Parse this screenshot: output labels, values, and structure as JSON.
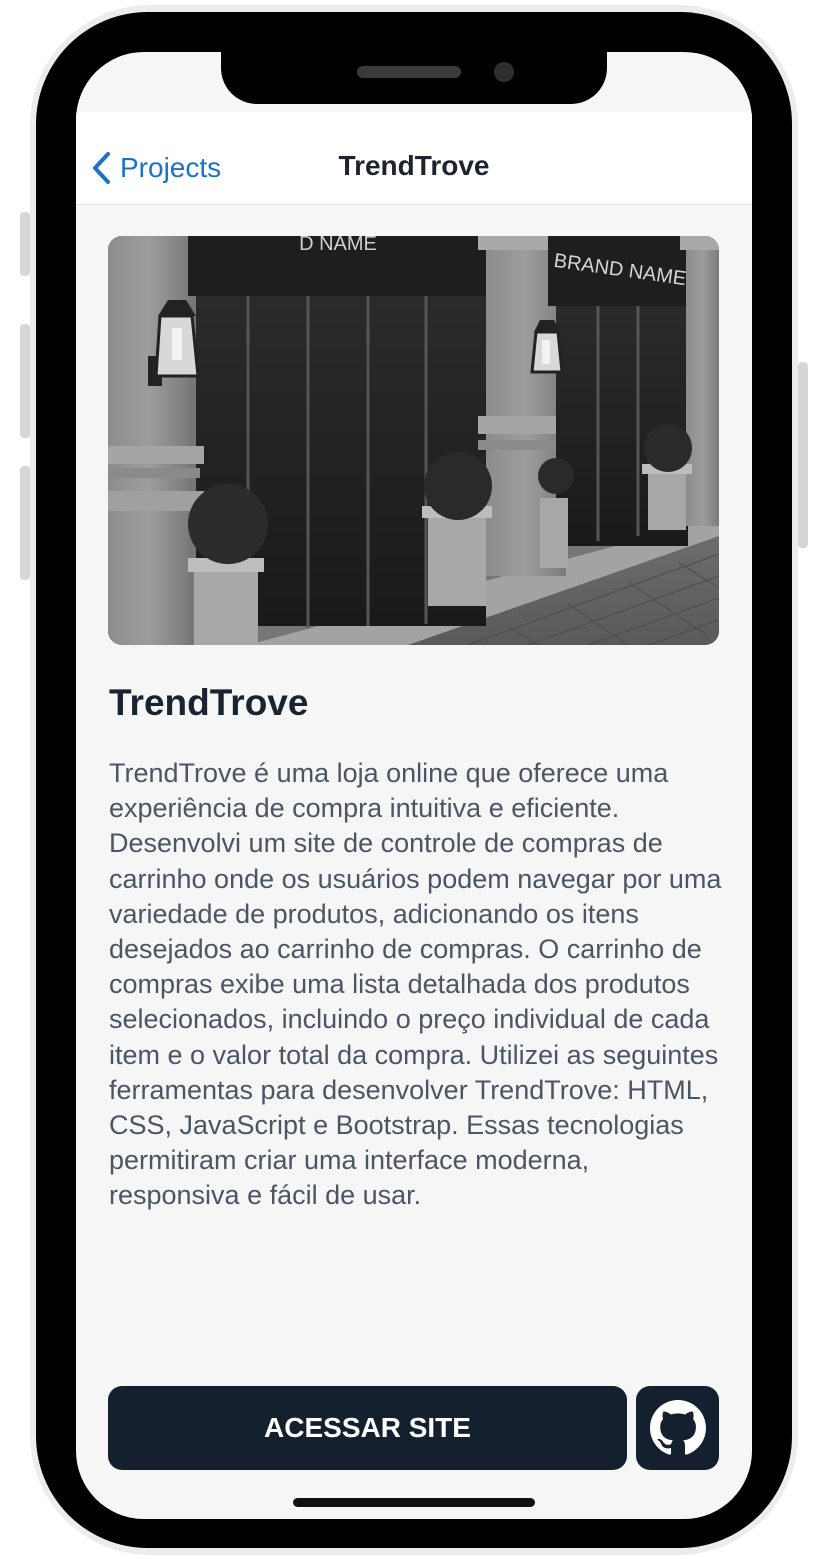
{
  "nav": {
    "back_label": "Projects",
    "title": "TrendTrove"
  },
  "hero": {
    "sign_left": "D NAME",
    "sign_right": "BRAND NAME"
  },
  "project": {
    "title": "TrendTrove",
    "description": "TrendTrove é uma loja online que oferece uma experiência de compra intuitiva e eficiente. Desenvolvi um site de controle de compras de carrinho onde os usuários podem navegar por uma variedade de produtos, adicionando os itens desejados ao carrinho de compras. O carrinho de compras exibe uma lista detalhada dos produtos selecionados, incluindo o preço individual de cada item e o valor total da compra. Utilizei as seguintes ferramentas para desenvolver TrendTrove: HTML, CSS, JavaScript e Bootstrap. Essas tecnologias permitiram criar uma interface moderna, responsiva e fácil de usar."
  },
  "actions": {
    "access_label": "ACESSAR SITE",
    "github_icon": "github-icon"
  },
  "colors": {
    "accent": "#1a73c9",
    "button_bg": "#15202f",
    "screen_bg": "#f6f6f7"
  }
}
